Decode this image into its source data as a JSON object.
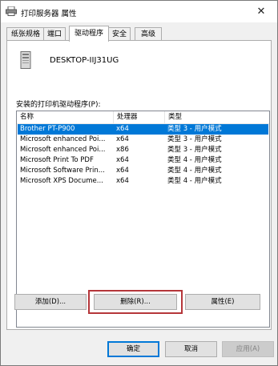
{
  "window": {
    "title": "打印服务器 属性",
    "close_glyph": "✕"
  },
  "tabs": [
    {
      "label": "纸张规格"
    },
    {
      "label": "端口"
    },
    {
      "label": "驱动程序",
      "active": true
    },
    {
      "label": "安全"
    },
    {
      "label": "高级"
    }
  ],
  "server": {
    "name": "DESKTOP-IIJ31UG"
  },
  "drivers": {
    "label": "安装的打印机驱动程序(P):",
    "columns": [
      "名称",
      "处理器",
      "类型"
    ],
    "rows": [
      {
        "name": "Brother PT-P900",
        "processor": "x64",
        "type": "类型 3 - 用户模式",
        "selected": true
      },
      {
        "name": "Microsoft enhanced Poi...",
        "processor": "x64",
        "type": "类型 3 - 用户模式"
      },
      {
        "name": "Microsoft enhanced Poi...",
        "processor": "x86",
        "type": "类型 3 - 用户模式"
      },
      {
        "name": "Microsoft Print To PDF",
        "processor": "x64",
        "type": "类型 4 - 用户模式"
      },
      {
        "name": "Microsoft Software Prin...",
        "processor": "x64",
        "type": "类型 4 - 用户模式"
      },
      {
        "name": "Microsoft XPS Docume...",
        "processor": "x64",
        "type": "类型 4 - 用户模式"
      }
    ]
  },
  "buttons": {
    "add": "添加(D)...",
    "remove": "删除(R)...",
    "properties": "属性(E)",
    "ok": "确定",
    "cancel": "取消",
    "apply": "应用(A)"
  },
  "colors": {
    "selection": "#0078d7",
    "highlight_box": "#b5363a"
  }
}
